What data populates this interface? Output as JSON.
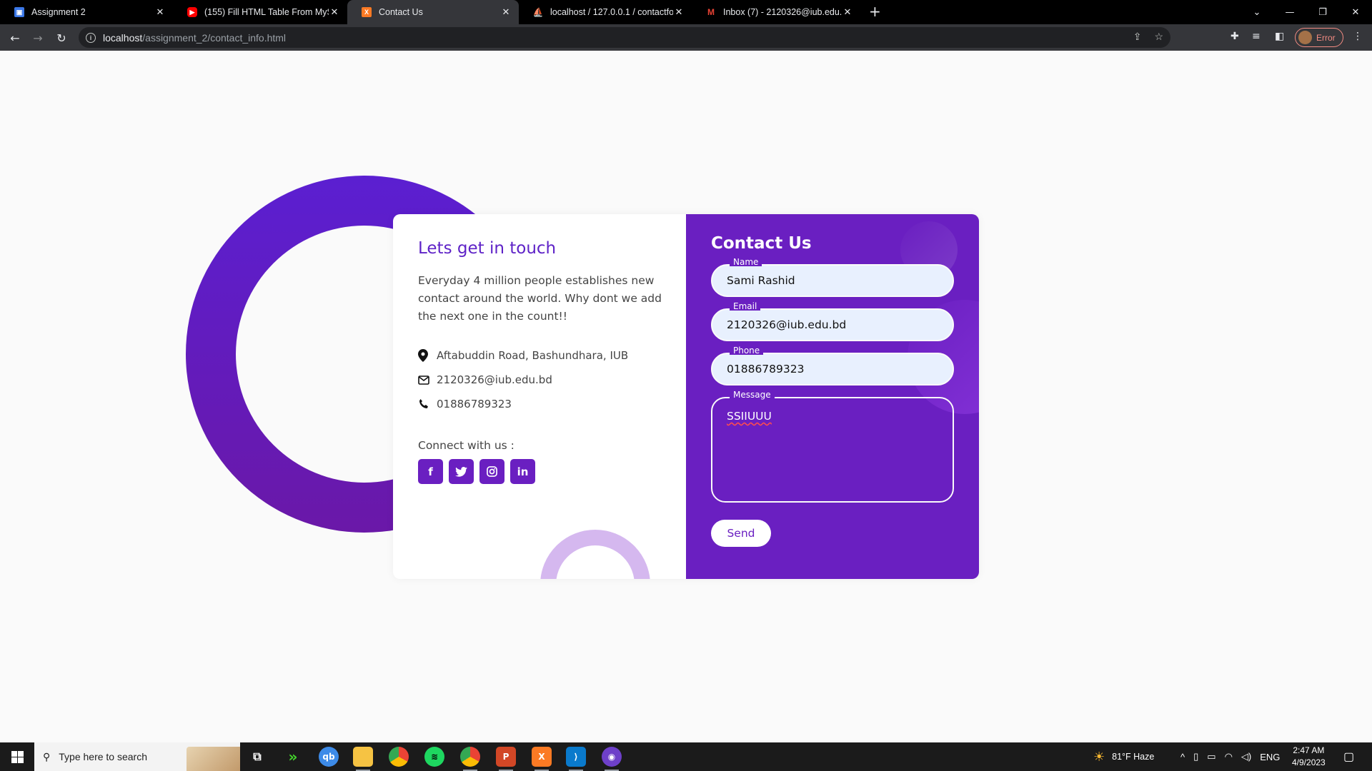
{
  "browser": {
    "tabs": [
      {
        "title": "Assignment 2",
        "favicon": "person-icon",
        "color": "#3b78e7"
      },
      {
        "title": "(155) Fill HTML Table From MySQ",
        "favicon": "youtube-icon",
        "color": "#ff0000"
      },
      {
        "title": "Contact Us",
        "favicon": "xampp-icon",
        "color": "#fb7a24"
      },
      {
        "title": "localhost / 127.0.0.1 / contactfor",
        "favicon": "phpmyadmin-icon",
        "color": "#f89c0e"
      },
      {
        "title": "Inbox (7) - 2120326@iub.edu.bd",
        "favicon": "gmail-icon",
        "color": "#ea4335"
      }
    ],
    "url_host": "localhost",
    "url_path": "/assignment_2/contact_info.html",
    "profile_label": "Error"
  },
  "info": {
    "title": "Lets get in touch",
    "text": "Everyday 4 million people establishes new contact around the world. Why dont we add the next one in the count!!",
    "address": "Aftabuddin Road, Bashundhara, IUB",
    "email": "2120326@iub.edu.bd",
    "phone": "01886789323",
    "connect_label": "Connect with us :",
    "socials": [
      "f",
      "twitter-icon",
      "instagram-icon",
      "in"
    ]
  },
  "form": {
    "title": "Contact Us",
    "name_label": "Name",
    "name_value": "Sami Rashid",
    "email_label": "Email",
    "email_value": "2120326@iub.edu.bd",
    "phone_label": "Phone",
    "phone_value": "01886789323",
    "message_label": "Message",
    "message_value": "SSIIUUU",
    "send_label": "Send"
  },
  "taskbar": {
    "search_placeholder": "Type here to search",
    "weather": "81°F  Haze",
    "language": "ENG",
    "time": "2:47 AM",
    "date": "4/9/2023"
  },
  "colors": {
    "accent": "#6a1fc1",
    "title_purple": "#5e22c7",
    "input_bg": "#e8f0fe"
  }
}
